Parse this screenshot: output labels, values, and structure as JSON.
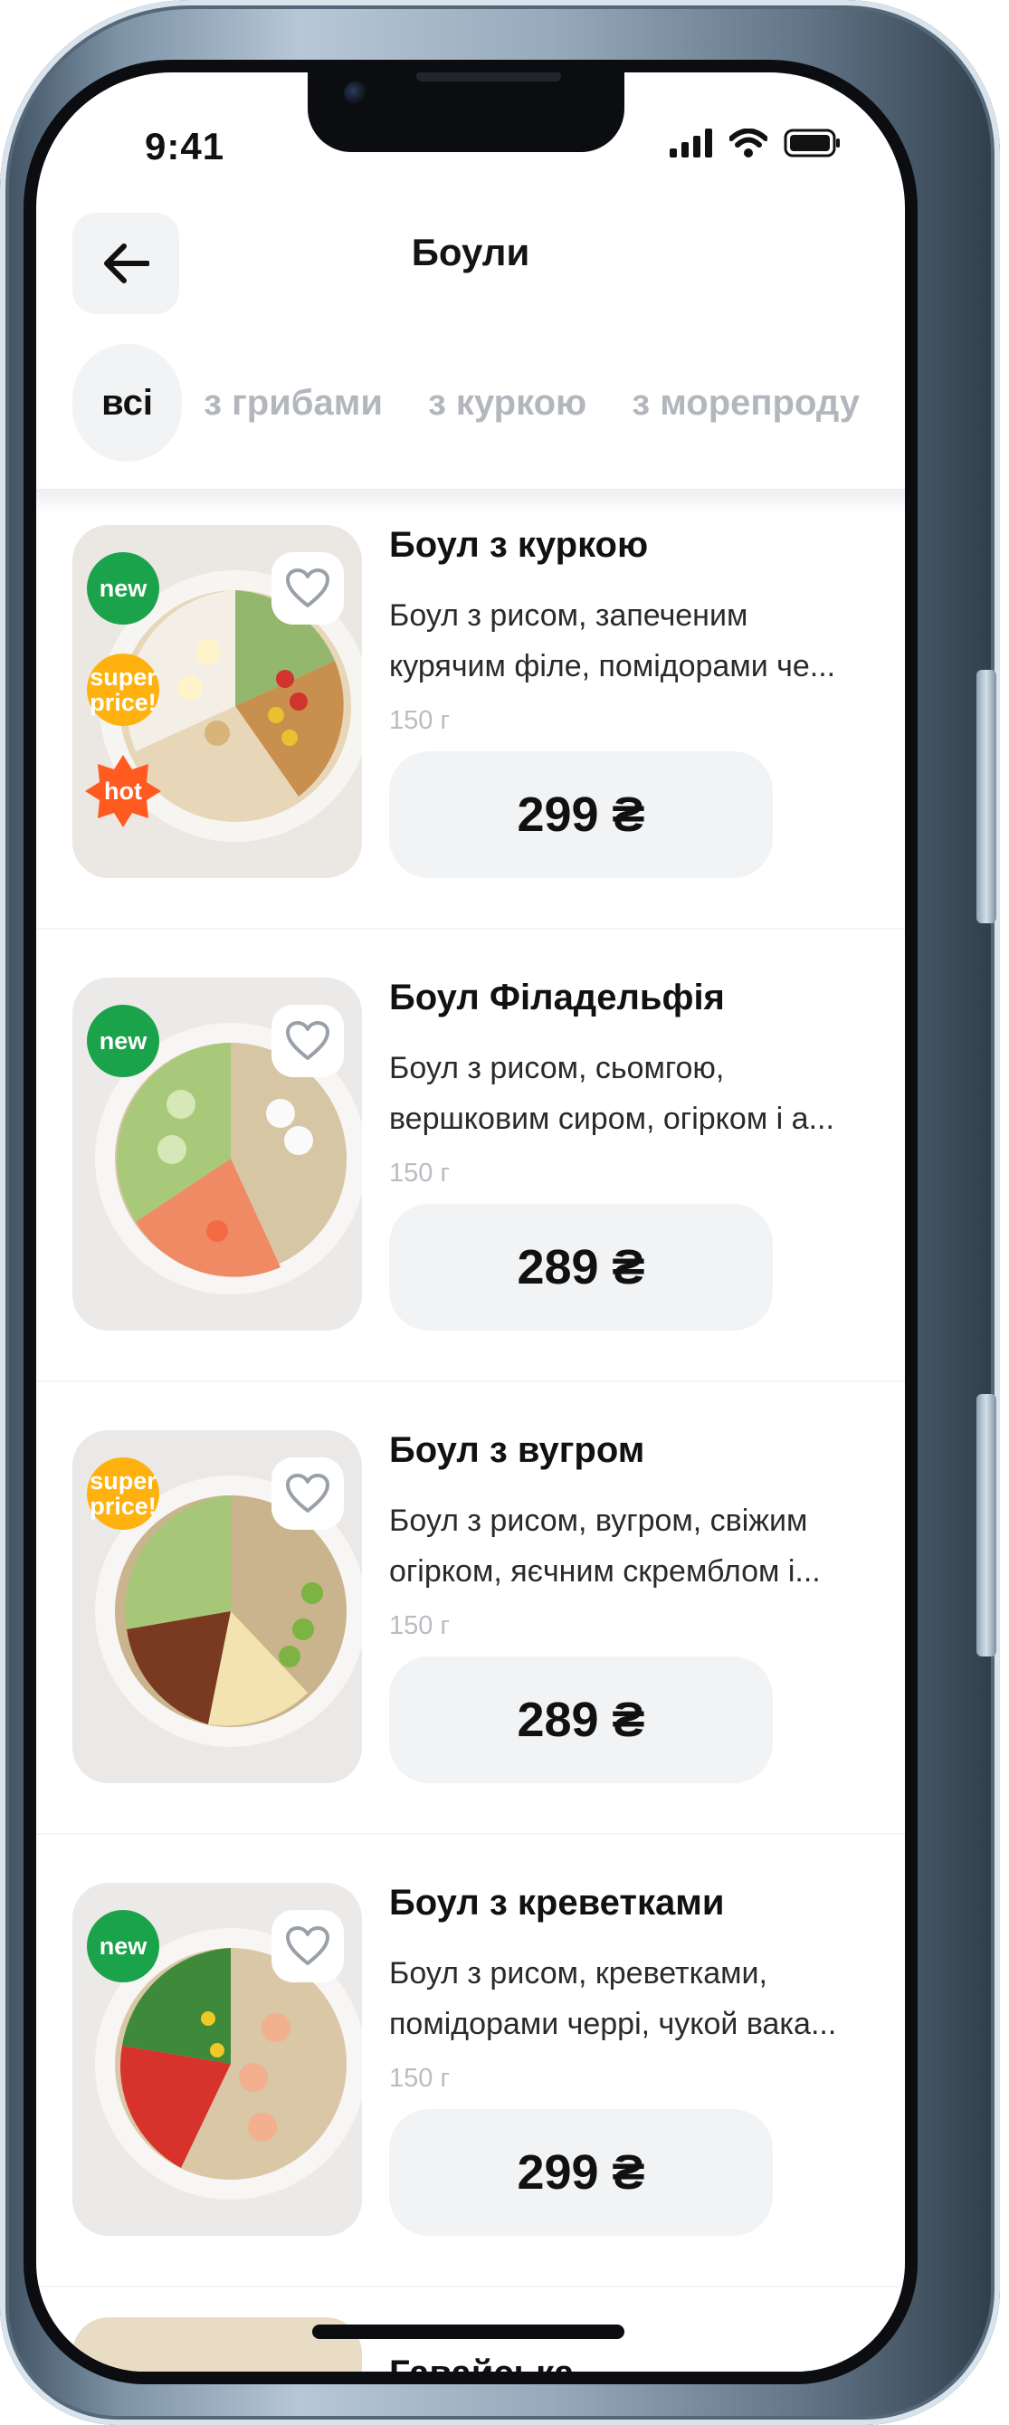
{
  "status_bar": {
    "time": "9:41"
  },
  "header": {
    "title": "Боули"
  },
  "tabs": [
    {
      "label": "всі",
      "active": true
    },
    {
      "label": "з грибами",
      "active": false
    },
    {
      "label": "з куркою",
      "active": false
    },
    {
      "label": "з морепроду",
      "active": false
    }
  ],
  "products": [
    {
      "name": "Боул з куркою",
      "desc_line1": "Боул з рисом, запеченим",
      "desc_line2": "курячим філе, помідорами че...",
      "weight": "150 г",
      "price": "299 ₴",
      "badges": [
        "new",
        "super price!",
        "hot"
      ]
    },
    {
      "name": "Боул Філадельфія",
      "desc_line1": "Боул з рисом, сьомгою,",
      "desc_line2": "вершковим сиром, огірком і а...",
      "weight": "150 г",
      "price": "289 ₴",
      "badges": [
        "new"
      ]
    },
    {
      "name": "Боул з вугром",
      "desc_line1": "Боул з рисом, вугром, свіжим",
      "desc_line2": "огірком, яєчним скремблом і...",
      "weight": "150 г",
      "price": "289 ₴",
      "badges": [
        "super price!"
      ]
    },
    {
      "name": "Боул з креветками",
      "desc_line1": "Боул з рисом, креветками,",
      "desc_line2": "помідорами черрі, чукой вака...",
      "weight": "150 г",
      "price": "299 ₴",
      "badges": [
        "new"
      ]
    }
  ],
  "next_product": {
    "name": "Гавайська"
  },
  "badge_labels": {
    "new": "new",
    "super_1": "super",
    "super_2": "price!",
    "hot": "hot"
  },
  "colors": {
    "new": "#1aa34a",
    "super": "#ffb20f",
    "hot": "#ff5a1f",
    "chip_bg": "#f2f3f5"
  },
  "icons": [
    "back-arrow-icon",
    "heart-icon",
    "signal-icon",
    "wifi-icon",
    "battery-icon"
  ]
}
